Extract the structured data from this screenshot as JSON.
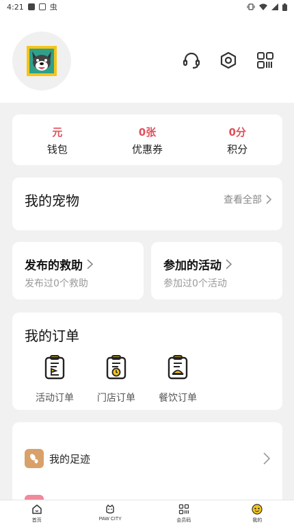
{
  "status_bar": {
    "time": "4:21",
    "carrier_char": "虫"
  },
  "stats": [
    {
      "value": "元",
      "label": "钱包"
    },
    {
      "value": "0张",
      "label": "优惠券"
    },
    {
      "value": "0分",
      "label": "积分"
    }
  ],
  "pets": {
    "title": "我的宠物",
    "more": "查看全部"
  },
  "rescue": {
    "title": "发布的救助",
    "subtitle": "发布过0个救助"
  },
  "activity": {
    "title": "参加的活动",
    "subtitle": "参加过0个活动"
  },
  "orders": {
    "title": "我的订单",
    "items": [
      {
        "label": "活动订单",
        "icon": "activity-order-icon"
      },
      {
        "label": "门店订单",
        "icon": "store-order-icon"
      },
      {
        "label": "餐饮订单",
        "icon": "food-order-icon"
      }
    ]
  },
  "list": {
    "footprint": "我的足迹"
  },
  "tabs": [
    {
      "label": "首页",
      "icon": "home-icon"
    },
    {
      "label": "PAW CITY",
      "icon": "paw-city-icon"
    },
    {
      "label": "会员码",
      "icon": "member-code-icon"
    },
    {
      "label": "我的",
      "icon": "profile-face-icon"
    }
  ],
  "colors": {
    "accent_red": "#e0505a",
    "brand_yellow": "#f5c518",
    "footprint_icon_bg": "#d9a16a"
  }
}
